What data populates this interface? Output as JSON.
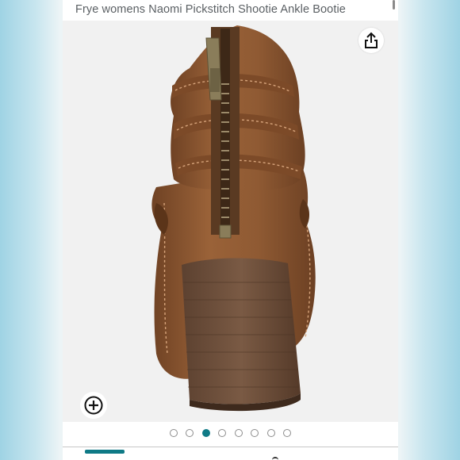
{
  "product": {
    "title": "Frye womens Naomi Pickstitch Shootie Ankle Bootie"
  },
  "toolbar": {
    "share_icon": "share-icon",
    "zoom_icon": "zoom-in-icon"
  },
  "carousel": {
    "total_images": 8,
    "active_index": 2
  },
  "colors": {
    "accent": "#0f7a86",
    "suede": "#8a5530",
    "heel": "#6b4a35"
  }
}
